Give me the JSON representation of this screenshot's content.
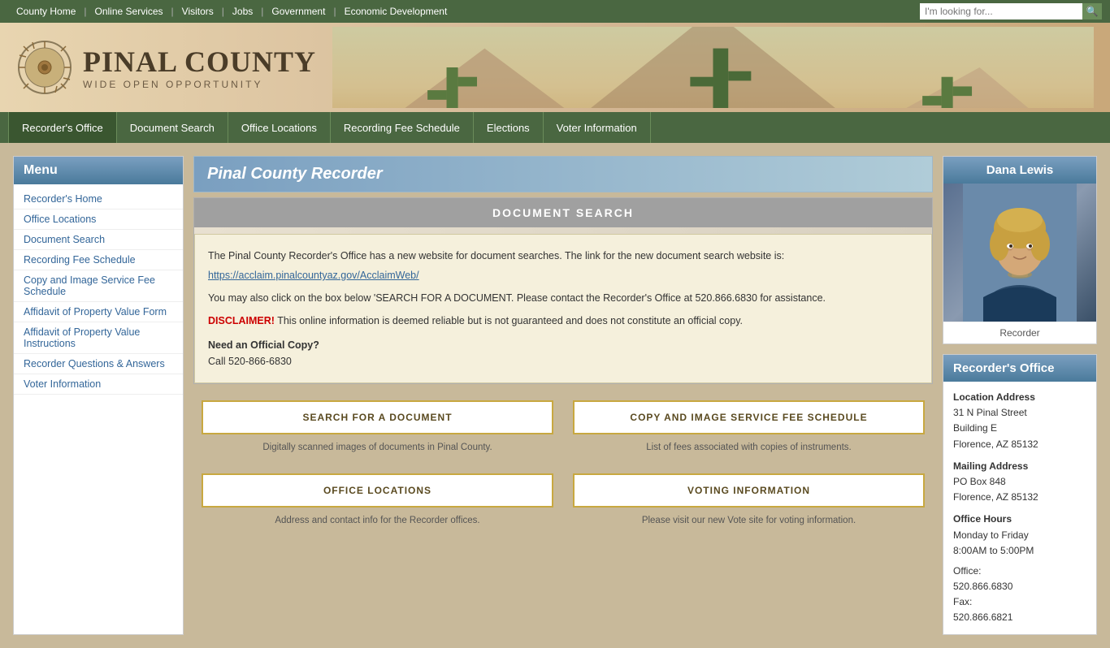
{
  "topnav": {
    "links": [
      {
        "label": "County Home",
        "href": "#"
      },
      {
        "label": "Online Services",
        "href": "#"
      },
      {
        "label": "Visitors",
        "href": "#"
      },
      {
        "label": "Jobs",
        "href": "#"
      },
      {
        "label": "Government",
        "href": "#"
      },
      {
        "label": "Economic Development",
        "href": "#"
      }
    ],
    "search_placeholder": "I'm looking for..."
  },
  "header": {
    "logo_name": "PINAL COUNTY",
    "logo_tagline": "WIDE OPEN OPPORTUNITY"
  },
  "mainnav": {
    "links": [
      {
        "label": "Recorder's Office",
        "active": true
      },
      {
        "label": "Document Search"
      },
      {
        "label": "Office Locations"
      },
      {
        "label": "Recording Fee Schedule"
      },
      {
        "label": "Elections"
      },
      {
        "label": "Voter Information"
      }
    ]
  },
  "sidebar": {
    "title": "Menu",
    "items": [
      {
        "label": "Recorder's Home"
      },
      {
        "label": "Office Locations"
      },
      {
        "label": "Document Search"
      },
      {
        "label": "Recording Fee Schedule"
      },
      {
        "label": "Copy and Image Service Fee Schedule"
      },
      {
        "label": "Affidavit of Property Value Form"
      },
      {
        "label": "Affidavit of Property Value Instructions"
      },
      {
        "label": "Recorder Questions & Answers"
      },
      {
        "label": "Voter Information"
      }
    ]
  },
  "main": {
    "page_title": "Pinal County Recorder",
    "doc_search_header": "DOCUMENT SEARCH",
    "doc_search_p1": "The Pinal County Recorder's Office has a new website for document searches. The link for the new document search website is:",
    "doc_search_link": "https://acclaim.pinalcountyaz.gov/AcclaimWeb/",
    "doc_search_p2": "You may also click on the box below 'SEARCH FOR A DOCUMENT. Please contact the Recorder's Office at 520.866.6830 for assistance.",
    "disclaimer_label": "DISCLAIMER!",
    "disclaimer_text": " This online information is deemed reliable but is not guaranteed and does not constitute an official copy.",
    "need_copy_label": "Need an Official Copy?",
    "need_copy_text": "Call 520-866-6830",
    "action_buttons": [
      {
        "label": "SEARCH FOR A DOCUMENT",
        "desc": "Digitally scanned images of documents in Pinal County."
      },
      {
        "label": "COPY AND IMAGE SERVICE FEE SCHEDULE",
        "desc": "List of fees associated with copies of instruments."
      },
      {
        "label": "OFFICE LOCATIONS",
        "desc": "Address and contact info for the Recorder offices."
      },
      {
        "label": "VOTING INFORMATION",
        "desc": "Please visit our new Vote site for voting information."
      }
    ]
  },
  "right_sidebar": {
    "recorder_title": "Dana Lewis",
    "recorder_label": "Recorder",
    "office_title": "Recorder's Office",
    "location_label": "Location Address",
    "location_line1": "31 N Pinal Street",
    "location_line2": "Building E",
    "location_line3": "Florence, AZ 85132",
    "mailing_label": "Mailing Address",
    "mailing_line1": "PO Box 848",
    "mailing_line2": "Florence, AZ 85132",
    "hours_label": "Office Hours",
    "hours_text": "Monday to Friday",
    "hours_time": "8:00AM to 5:00PM",
    "office_label": "Office:",
    "office_phone": "520.866.6830",
    "fax_label": "Fax:",
    "fax_phone": "520.866.6821"
  }
}
